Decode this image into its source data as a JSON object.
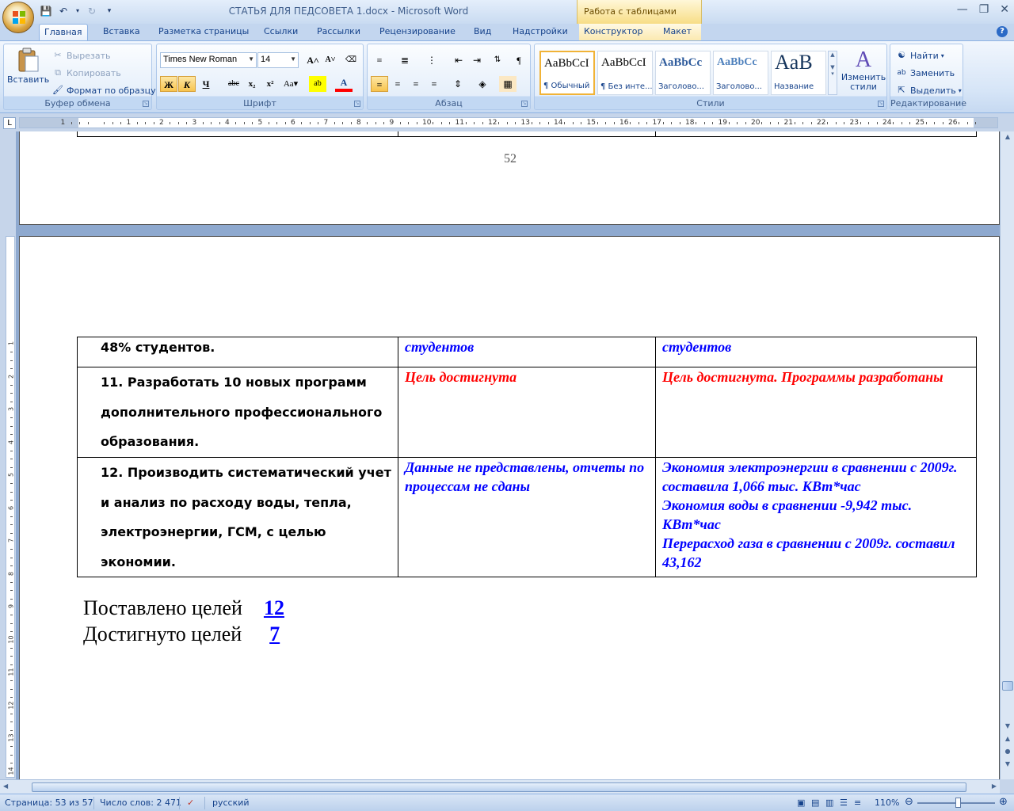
{
  "window": {
    "title": "СТАТЬЯ ДЛЯ ПЕДСОВЕТА 1.docx - Microsoft Word",
    "context_tab_header": "Работа с таблицами"
  },
  "tabs": [
    {
      "label": "Главная",
      "active": true
    },
    {
      "label": "Вставка"
    },
    {
      "label": "Разметка страницы"
    },
    {
      "label": "Ссылки"
    },
    {
      "label": "Рассылки"
    },
    {
      "label": "Рецензирование"
    },
    {
      "label": "Вид"
    },
    {
      "label": "Надстройки"
    },
    {
      "label": "Конструктор"
    },
    {
      "label": "Макет"
    }
  ],
  "ribbon": {
    "clipboard": {
      "label": "Буфер обмена",
      "paste": "Вставить",
      "cut": "Вырезать",
      "copy": "Копировать",
      "format_painter": "Формат по образцу"
    },
    "font": {
      "label": "Шрифт",
      "font_name": "Times New Roman",
      "font_size": "14"
    },
    "paragraph": {
      "label": "Абзац"
    },
    "styles": {
      "label": "Стили",
      "items": [
        {
          "sample": "AaBbCcI",
          "name": "¶ Обычный"
        },
        {
          "sample": "AaBbCcI",
          "name": "¶ Без инте..."
        },
        {
          "sample": "AaBbCc",
          "name": "Заголово..."
        },
        {
          "sample": "AaBbCc",
          "name": "Заголово..."
        },
        {
          "sample": "AaB",
          "name": "Название"
        }
      ],
      "change_styles": "Изменить стили"
    },
    "editing": {
      "label": "Редактирование",
      "find": "Найти",
      "replace": "Заменить",
      "select": "Выделить"
    }
  },
  "document": {
    "page_number": "52",
    "table_rows": [
      {
        "col1": "48% студентов.",
        "col2": "студентов",
        "col3": "студентов",
        "col2_color": "#0000ff",
        "col3_color": "#0000ff"
      },
      {
        "col1": "11.  Разработать 10 новых программ дополнительного профессионального образования.",
        "col2": "Цель достигнута",
        "col3": "Цель достигнута. Программы разработаны",
        "col2_color": "#ff0000",
        "col3_color": "#ff0000"
      },
      {
        "col1": "12. Производить систематический учет и анализ по расходу воды, тепла, электроэнергии, ГСМ, с целью экономии.",
        "col2": "Данные не представлены, отчеты по процессам не сданы",
        "col3_lines": [
          "Экономия электроэнергии в сравнении с 2009г. составила 1,066 тыс. КВт*час",
          "Экономия воды  в сравнении -9,942 тыс. КВт*час",
          "Перерасход газа в сравнении с 2009г. составил 43,162"
        ],
        "col2_color": "#0000ff",
        "col3_color": "#0000ff"
      }
    ],
    "summary": {
      "goals_set_label": "Поставлено целей",
      "goals_set_value": "12",
      "goals_achieved_label": "Достигнуто целей",
      "goals_achieved_value": "7"
    }
  },
  "statusbar": {
    "page": "Страница: 53 из 57",
    "words": "Число слов: 2 471",
    "language": "русский",
    "zoom": "110%"
  },
  "colors": {
    "accent_blue": "#15428b",
    "doc_blue_text": "#0000ff",
    "doc_red_text": "#ff0000"
  }
}
